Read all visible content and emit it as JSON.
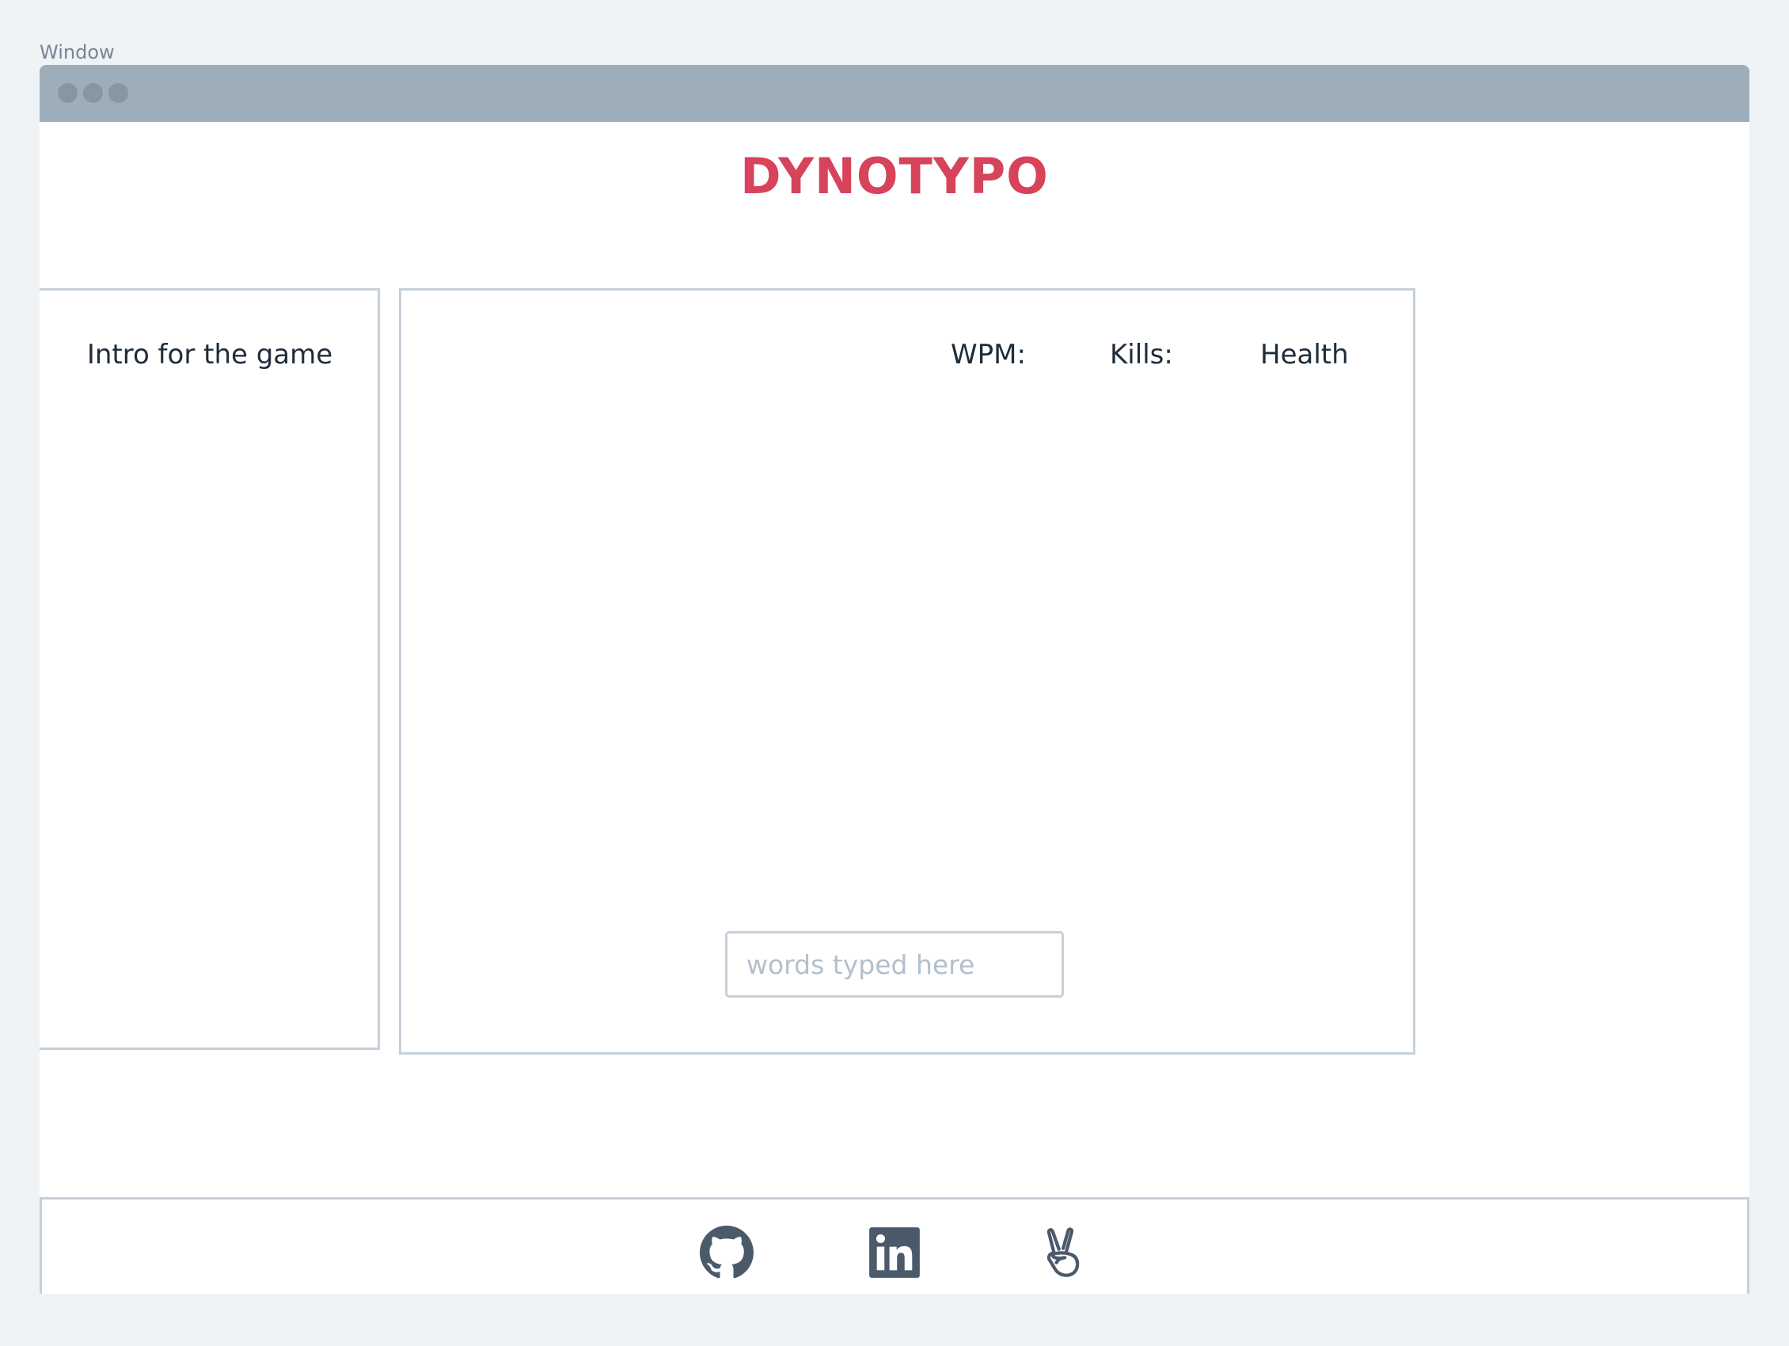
{
  "window": {
    "label": "Window"
  },
  "header": {
    "title": "DYNOTYPO"
  },
  "intro": {
    "text": "Intro for the game"
  },
  "stats": {
    "wpm_label": "WPM:",
    "kills_label": "Kills:",
    "health_label": "Health"
  },
  "input": {
    "placeholder": "words typed here",
    "value": ""
  },
  "footer": {
    "icons": [
      "github-icon",
      "linkedin-icon",
      "angellist-icon"
    ]
  },
  "colors": {
    "brand": "#d6435a",
    "titlebar": "#9eadba",
    "border": "#c6d0da",
    "text": "#1f2c3a",
    "icon": "#4a5a6a",
    "background": "#eff3f6"
  }
}
